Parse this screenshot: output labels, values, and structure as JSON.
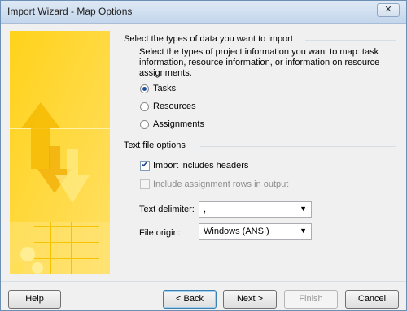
{
  "window": {
    "title": "Import Wizard - Map Options",
    "close_glyph": "✕"
  },
  "section1": {
    "heading": "Select the types of data you want to import",
    "description_line1": "Select the types of project information you want to map: task",
    "description_line2": "information, resource information, or information on resource",
    "description_line3": "assignments.",
    "options": [
      {
        "label": "Tasks",
        "selected": true
      },
      {
        "label": "Resources",
        "selected": false
      },
      {
        "label": "Assignments",
        "selected": false
      }
    ]
  },
  "section2": {
    "heading": "Text file options",
    "import_headers": {
      "label": "Import includes headers",
      "checked": true
    },
    "include_assignment_rows": {
      "label": "Include assignment rows in output",
      "checked": false,
      "enabled": false
    },
    "text_delimiter": {
      "label": "Text delimiter:",
      "value": ","
    },
    "file_origin": {
      "label": "File origin:",
      "value": "Windows (ANSI)"
    }
  },
  "buttons": {
    "help": "Help",
    "back": "< Back",
    "next": "Next >",
    "finish": "Finish",
    "cancel": "Cancel"
  },
  "icons": {
    "check_glyph": "✔",
    "dropdown_glyph": "▼"
  }
}
